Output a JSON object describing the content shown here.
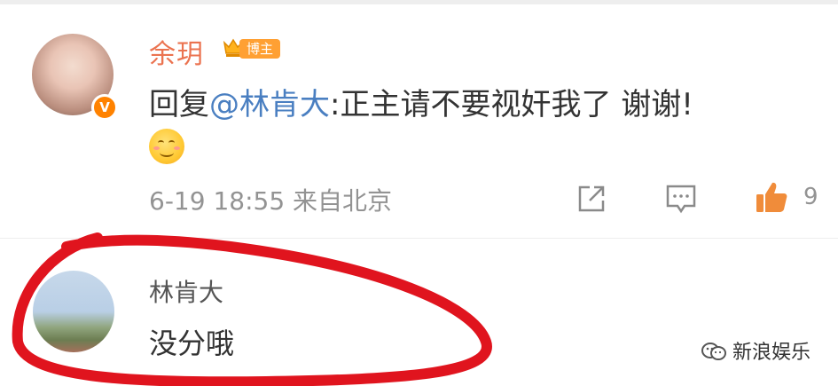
{
  "comment1": {
    "username": "余玥",
    "role_tag": "博主",
    "verified_badge": "V",
    "reply_prefix": "回复",
    "mention": "@林肯大",
    "text": ":正主请不要视奸我了 谢谢!",
    "emoji": "smile-emoji",
    "timestamp": "6-19 18:55",
    "location": "来自北京",
    "like_count": "9"
  },
  "comment2": {
    "username": "林肯大",
    "text": "没分哦"
  },
  "watermark": {
    "text": "新浪娱乐"
  },
  "colors": {
    "name_highlight": "#eb7350",
    "tag_bg": "#ffa033",
    "mention": "#4a7fc1",
    "like": "#f08c3a",
    "annotation": "#e0141e"
  },
  "icons": [
    "share-icon",
    "comment-icon",
    "like-icon",
    "crown-icon",
    "weibo-watermark-icon"
  ]
}
